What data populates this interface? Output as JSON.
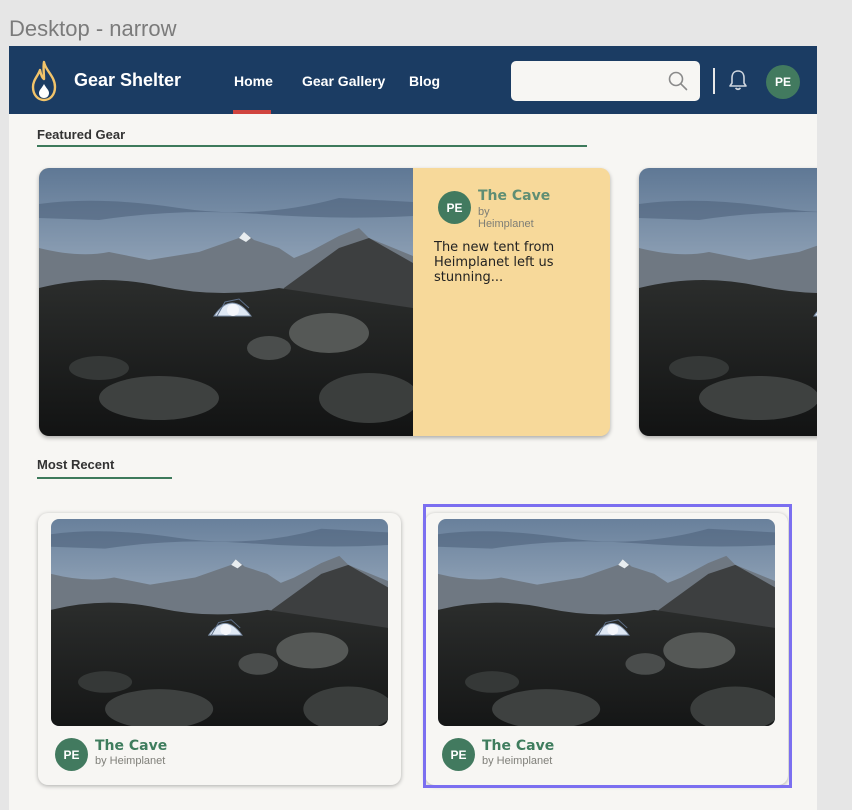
{
  "frame_label": "Desktop - narrow",
  "header": {
    "brand": "Gear Shelter",
    "nav": [
      "Home",
      "Gear Gallery",
      "Blog"
    ],
    "active_nav": "Home",
    "search": {
      "value": "",
      "placeholder": ""
    },
    "avatar_initials": "PE",
    "icons": [
      "flame-logo-icon",
      "search-icon",
      "bell-icon"
    ]
  },
  "featured": {
    "section_title": "Featured Gear",
    "card": {
      "avatar": "PE",
      "title": "The Cave",
      "by": "by Heimplanet",
      "description": "The new tent from Heimplanet left us stunning..."
    }
  },
  "recent": {
    "section_title": "Most Recent",
    "cards": [
      {
        "avatar": "PE",
        "title": "The Cave",
        "by": "by Heimplanet"
      },
      {
        "avatar": "PE",
        "title": "The Cave",
        "by": "by Heimplanet"
      }
    ]
  },
  "colors": {
    "header_bg": "#1b3c63",
    "accent_green": "#427a5f",
    "featured_panel": "#f7d99a",
    "nav_active": "#d0443e",
    "selection": "#7b6ff0"
  }
}
